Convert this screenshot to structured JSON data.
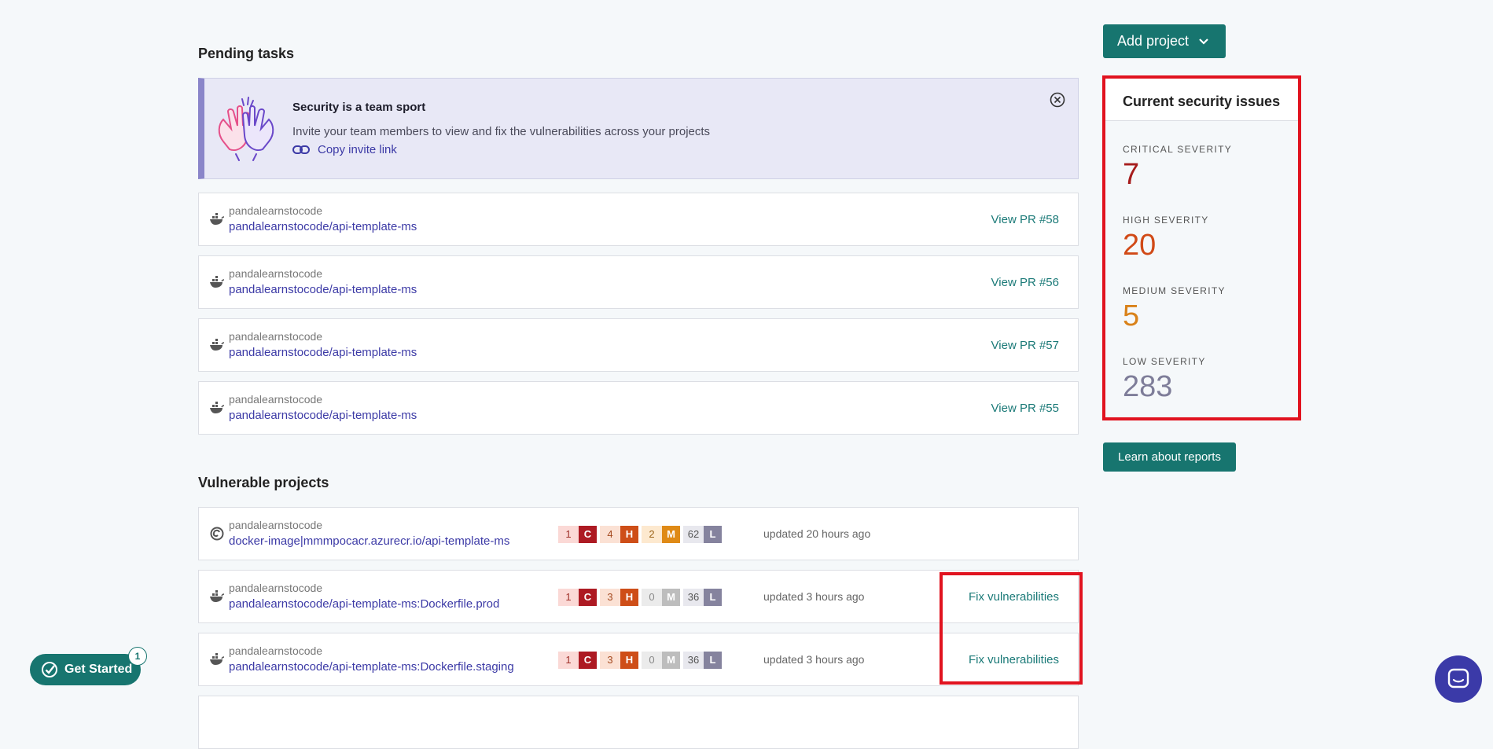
{
  "pending": {
    "title": "Pending tasks",
    "banner": {
      "title": "Security is a team sport",
      "text": "Invite your team members to view and fix the vulnerabilities across your projects",
      "link": "Copy invite link"
    },
    "items": [
      {
        "org": "pandalearnstocode",
        "project": "pandalearnstocode/api-template-ms",
        "action": "View PR #58"
      },
      {
        "org": "pandalearnstocode",
        "project": "pandalearnstocode/api-template-ms",
        "action": "View PR #56"
      },
      {
        "org": "pandalearnstocode",
        "project": "pandalearnstocode/api-template-ms",
        "action": "View PR #57"
      },
      {
        "org": "pandalearnstocode",
        "project": "pandalearnstocode/api-template-ms",
        "action": "View PR #55"
      }
    ]
  },
  "vulnerable": {
    "title": "Vulnerable projects",
    "items": [
      {
        "org": "pandalearnstocode",
        "project": "docker-image|mmmpocacr.azurecr.io/api-template-ms",
        "critical": "1",
        "critical_label": "C",
        "high": "4",
        "high_label": "H",
        "medium": "2",
        "medium_label": "M",
        "low": "62",
        "low_label": "L",
        "updated": "updated 20 hours ago",
        "action": ""
      },
      {
        "org": "pandalearnstocode",
        "project": "pandalearnstocode/api-template-ms:Dockerfile.prod",
        "critical": "1",
        "critical_label": "C",
        "high": "3",
        "high_label": "H",
        "medium": "0",
        "medium_label": "M",
        "low": "36",
        "low_label": "L",
        "updated": "updated 3 hours ago",
        "action": "Fix vulnerabilities"
      },
      {
        "org": "pandalearnstocode",
        "project": "pandalearnstocode/api-template-ms:Dockerfile.staging",
        "critical": "1",
        "critical_label": "C",
        "high": "3",
        "high_label": "H",
        "medium": "0",
        "medium_label": "M",
        "low": "36",
        "low_label": "L",
        "updated": "updated 3 hours ago",
        "action": "Fix vulnerabilities"
      }
    ]
  },
  "sidebar": {
    "add_project": "Add project",
    "issues_title": "Current security issues",
    "critical_label": "CRITICAL SEVERITY",
    "critical_value": "7",
    "high_label": "HIGH SEVERITY",
    "high_value": "20",
    "medium_label": "MEDIUM SEVERITY",
    "medium_value": "5",
    "low_label": "LOW SEVERITY",
    "low_value": "283",
    "learn_reports": "Learn about reports"
  },
  "get_started": {
    "label": "Get Started",
    "count": "1"
  },
  "colors": {
    "brand": "#17756f",
    "critical": "#a61c1c",
    "high": "#d14a17",
    "medium": "#d9821a",
    "low": "#7e7d99",
    "highlight": "#e1131f"
  },
  "icons": [
    "docker-icon",
    "debian-icon",
    "high-five-icon",
    "close-circle-icon",
    "link-icon",
    "chevron-down-icon",
    "check-badge-icon",
    "chat-icon"
  ]
}
